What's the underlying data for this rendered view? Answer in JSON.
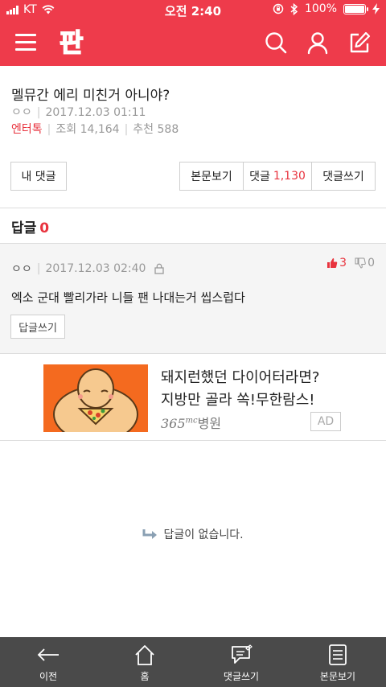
{
  "status_bar": {
    "carrier": "KT",
    "time": "오전 2:40",
    "battery": "100%"
  },
  "header": {
    "logo_text": "판",
    "colors": {
      "accent": "#ee3b4b"
    }
  },
  "post": {
    "title": "멜뮤간 에리 미친거 아니야?",
    "author": "ㅇㅇ",
    "date": "2017.12.03 01:11",
    "category": "엔터톡",
    "views_label": "조회",
    "views": "14,164",
    "likes_label": "추천",
    "likes": "588"
  },
  "actions": {
    "my_comments": "내 댓글",
    "view_post": "본문보기",
    "comments_label": "댓글",
    "comments_count": "1,130",
    "write_comment": "댓글쓰기"
  },
  "replies": {
    "label": "답글",
    "count": "0"
  },
  "comment": {
    "author": "ㅇㅇ",
    "date": "2017.12.03 02:40",
    "up_count": "3",
    "down_count": "0",
    "text": "엑소 군대 빨리가라 니들 팬 나대는거 씹스럽다",
    "reply_button": "답글쓰기"
  },
  "ad": {
    "line1": "돼지런했던 다이어터라면?",
    "line2": "지방만 골라 쏙!무한람스!",
    "brand_num": "365",
    "brand_mc": "mc",
    "brand_name": "병원",
    "badge": "AD"
  },
  "empty_message": "답글이 없습니다.",
  "bottom_nav": {
    "back": "이전",
    "home": "홈",
    "write": "댓글쓰기",
    "view_post": "본문보기"
  }
}
